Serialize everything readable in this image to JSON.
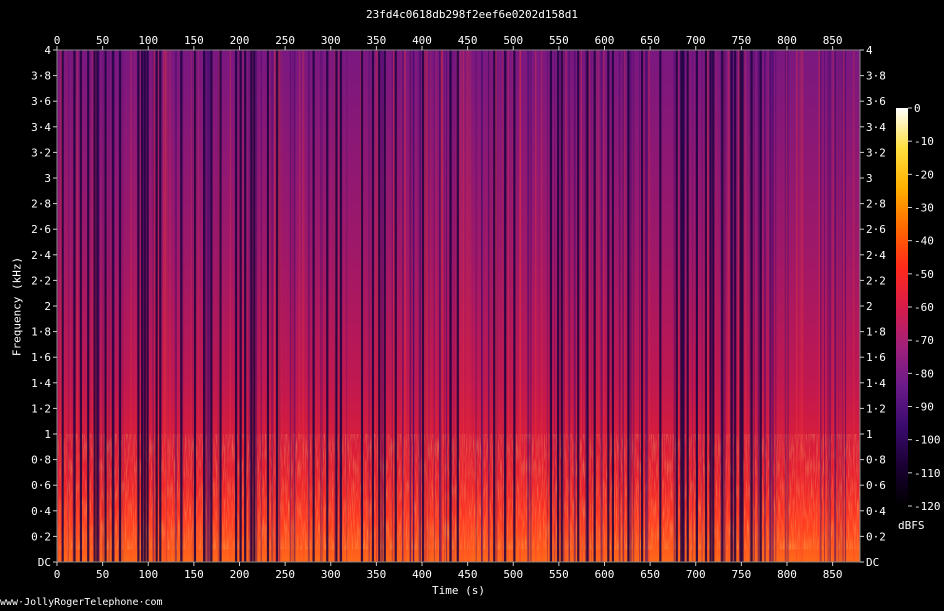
{
  "chart_data": {
    "type": "heatmap",
    "title": "23fd4c0618db298f2eef6e0202d158d1",
    "xlabel": "Time (s)",
    "ylabel": "Frequency (kHz)",
    "xlim": [
      0,
      880
    ],
    "ylim": [
      0,
      4
    ],
    "x_ticks": [
      "0",
      "50",
      "100",
      "150",
      "200",
      "250",
      "300",
      "350",
      "400",
      "450",
      "500",
      "550",
      "600",
      "650",
      "700",
      "750",
      "800",
      "850"
    ],
    "x_tick_values": [
      0,
      50,
      100,
      150,
      200,
      250,
      300,
      350,
      400,
      450,
      500,
      550,
      600,
      650,
      700,
      750,
      800,
      850
    ],
    "y_ticks": [
      "DC",
      "0·2",
      "0·4",
      "0·6",
      "0·8",
      "1",
      "1·2",
      "1·4",
      "1·6",
      "1·8",
      "2",
      "2·2",
      "2·4",
      "2·6",
      "2·8",
      "3",
      "3·2",
      "3·4",
      "3·6",
      "3·8",
      "4"
    ],
    "y_tick_values": [
      0,
      0.2,
      0.4,
      0.6,
      0.8,
      1,
      1.2,
      1.4,
      1.6,
      1.8,
      2,
      2.2,
      2.4,
      2.6,
      2.8,
      3,
      3.2,
      3.4,
      3.6,
      3.8,
      4
    ],
    "colorbar": {
      "unit": "dBFS",
      "ticks": [
        "0",
        "-10",
        "-20",
        "-30",
        "-40",
        "-50",
        "-60",
        "-70",
        "-80",
        "-90",
        "-100",
        "-110",
        "-120"
      ],
      "tick_values": [
        0,
        -10,
        -20,
        -30,
        -40,
        -50,
        -60,
        -70,
        -80,
        -90,
        -100,
        -110,
        -120
      ],
      "range": [
        -120,
        0
      ],
      "colors": [
        "#000000",
        "#1a0033",
        "#3a0a6e",
        "#6a1a8a",
        "#a0207a",
        "#d81c4a",
        "#ff2a1a",
        "#ff6a00",
        "#ffb000",
        "#ffe040",
        "#ffffc0",
        "#ffffff"
      ]
    },
    "silent_time_bands_s": [
      5,
      18,
      25,
      33,
      40,
      43,
      52,
      60,
      68,
      88,
      92,
      95,
      98,
      108,
      112,
      135,
      150,
      160,
      168,
      178,
      195,
      200,
      205,
      212,
      215,
      230,
      240,
      280,
      295,
      305,
      310,
      333,
      345,
      352,
      358,
      370,
      400,
      430,
      438,
      478,
      490,
      500,
      540,
      548,
      552,
      570,
      580,
      588,
      603,
      608,
      625,
      640,
      660,
      678,
      683,
      685,
      690,
      700,
      710,
      715,
      718,
      728,
      738,
      742,
      748,
      750,
      760,
      770
    ]
  },
  "watermark": "www·JollyRogerTelephone·com"
}
